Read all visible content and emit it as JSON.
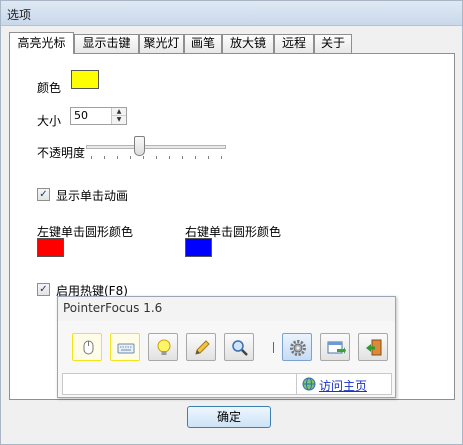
{
  "window": {
    "title": "选项"
  },
  "tabs": [
    {
      "label": "高亮光标",
      "active": true
    },
    {
      "label": "显示击键"
    },
    {
      "label": "聚光灯"
    },
    {
      "label": "画笔"
    },
    {
      "label": "放大镜"
    },
    {
      "label": "远程"
    },
    {
      "label": "关于"
    }
  ],
  "highlight": {
    "color_label": "颜色",
    "color_value": "#ffff00",
    "size_label": "大小",
    "size_value": "50",
    "opacity_label": "不透明度",
    "opacity_level": 0.37,
    "show_click_anim": {
      "label": "显示单击动画",
      "checked": true
    },
    "left_click": {
      "label": "左键单击圆形颜色",
      "color": "#ff0000"
    },
    "right_click": {
      "label": "右键单击圆形颜色",
      "color": "#0000ff"
    },
    "hotkey": {
      "label": "启用热键(F8)",
      "checked": true
    }
  },
  "popup": {
    "title": "PointerFocus 1.6",
    "tools": [
      {
        "icon": "mouse-icon",
        "state": "highlighted"
      },
      {
        "icon": "keyboard-icon",
        "state": "highlighted"
      },
      {
        "icon": "spotlight-icon",
        "state": "normal"
      },
      {
        "icon": "pen-icon",
        "state": "normal"
      },
      {
        "icon": "magnifier-icon",
        "state": "normal"
      },
      {
        "icon": "gear-icon",
        "state": "selected"
      },
      {
        "icon": "remote-icon",
        "state": "normal"
      },
      {
        "icon": "exit-icon",
        "state": "normal"
      }
    ],
    "homepage_link": "访问主页"
  },
  "ok_button": "确定"
}
